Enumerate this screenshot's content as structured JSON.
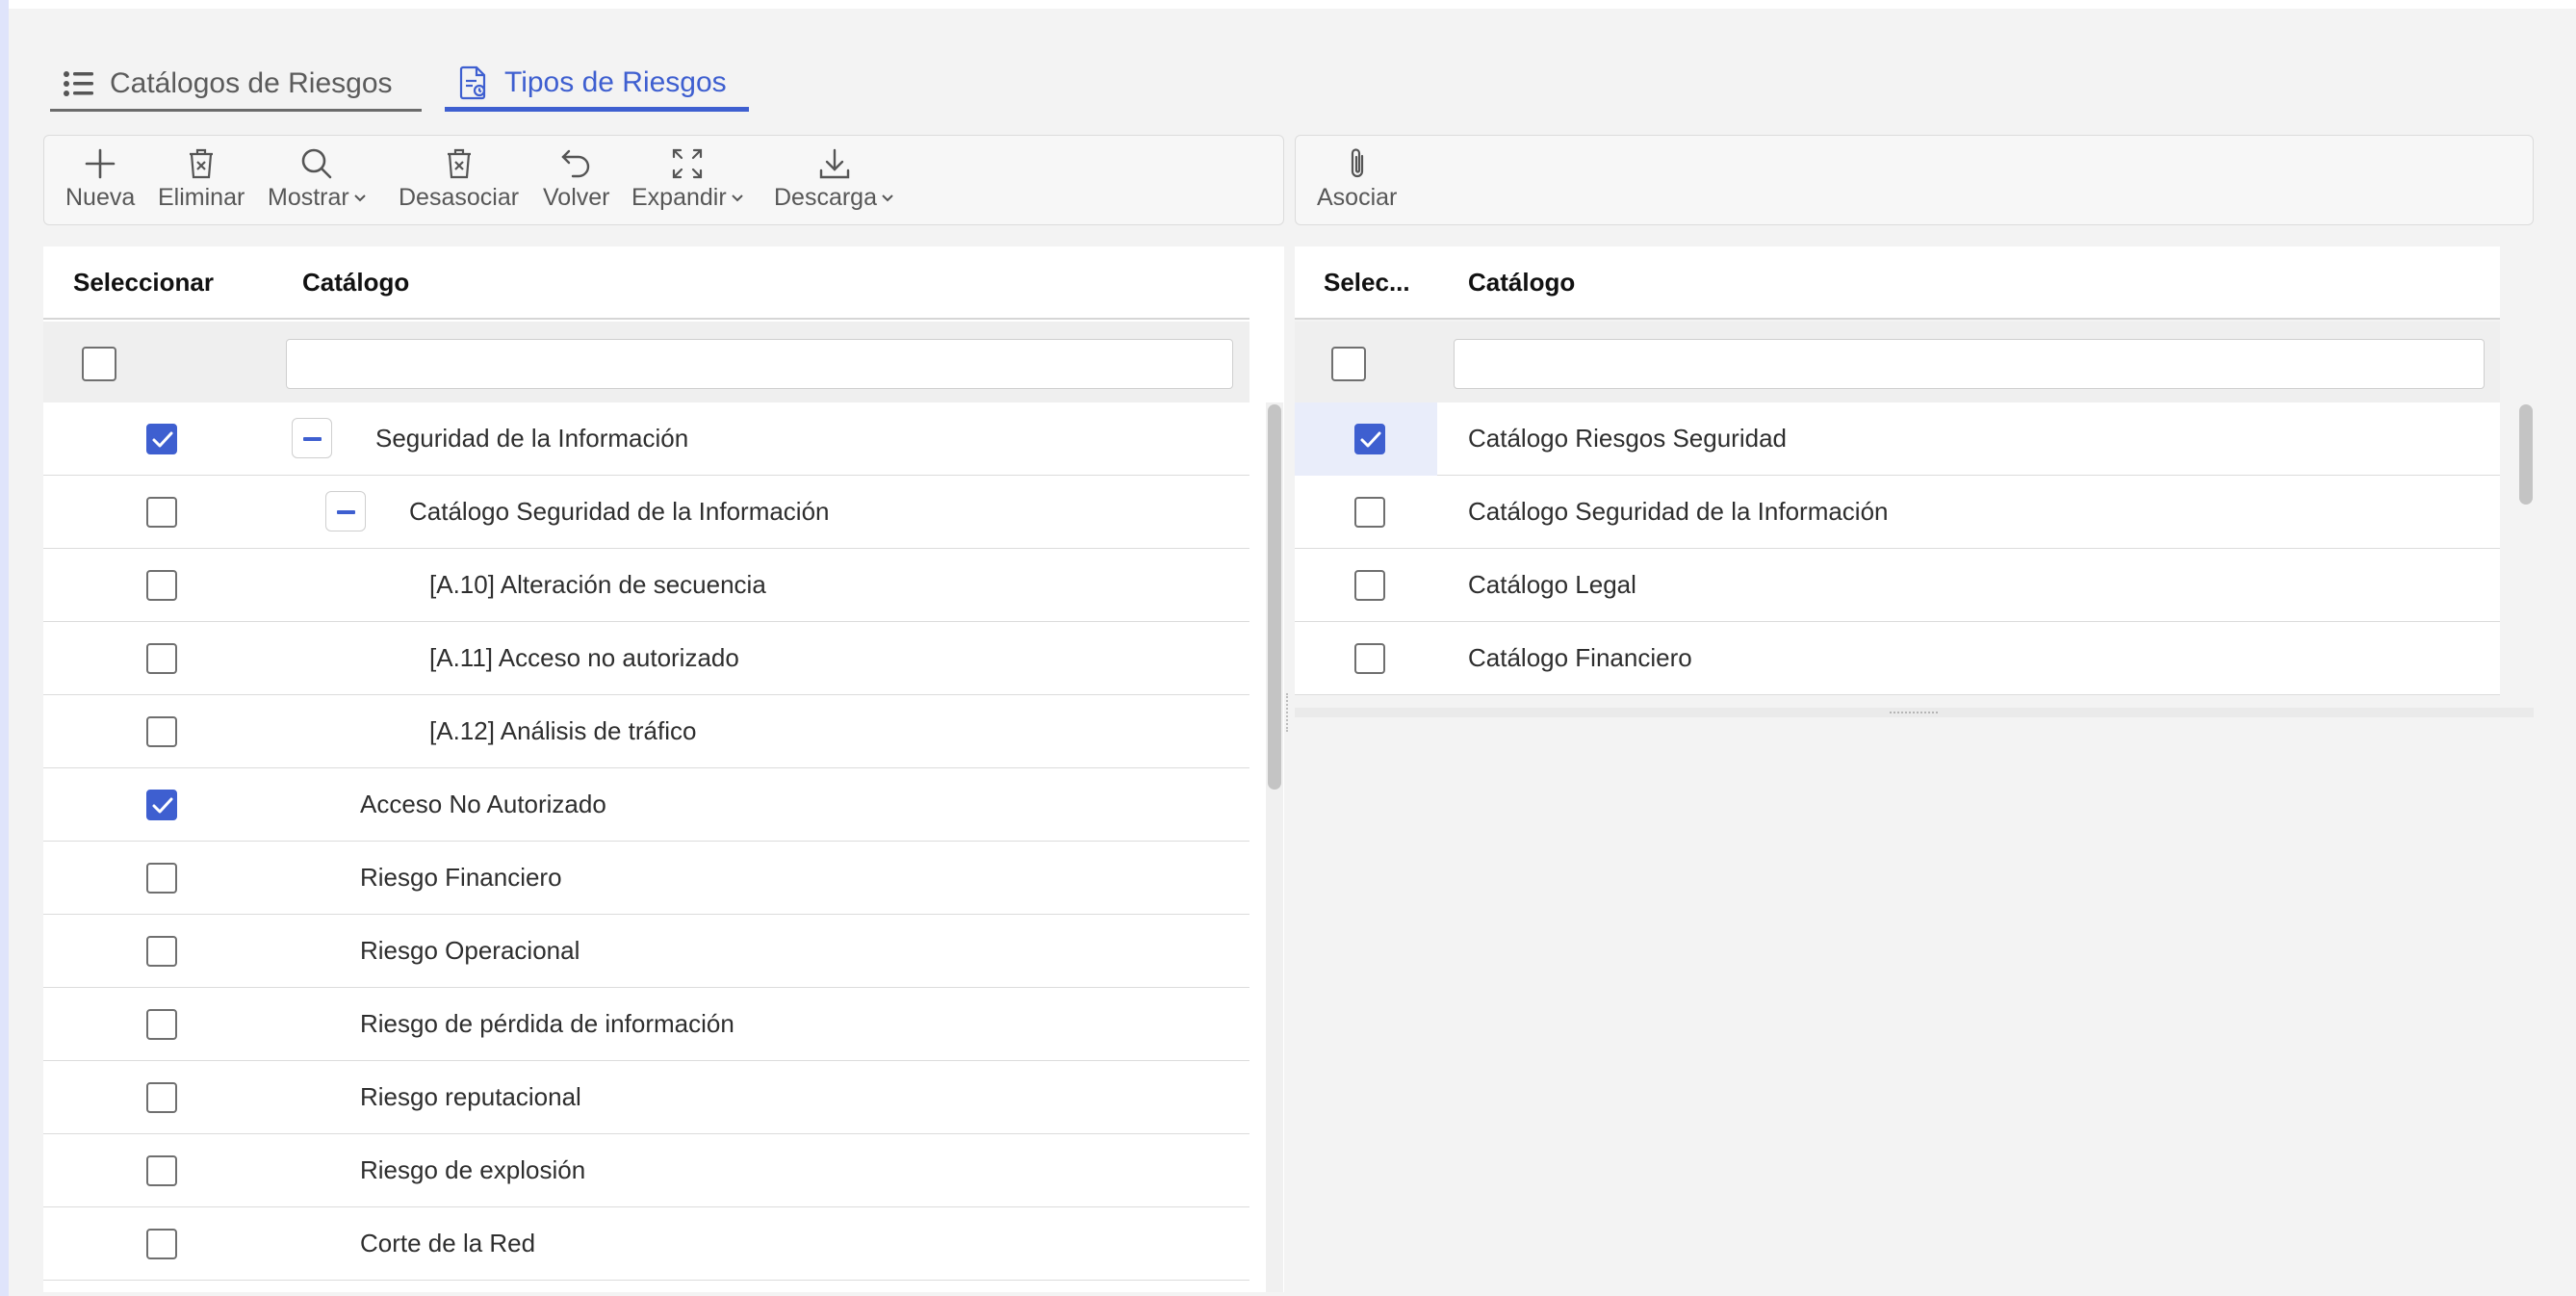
{
  "tabs": [
    {
      "label": "Catálogos de Riesgos",
      "icon": "list-icon",
      "active": false
    },
    {
      "label": "Tipos de Riesgos",
      "icon": "document-icon",
      "active": true
    }
  ],
  "toolbar_left": {
    "nueva": "Nueva",
    "eliminar": "Eliminar",
    "mostrar": "Mostrar",
    "desasociar": "Desasociar",
    "volver": "Volver",
    "expandir": "Expandir",
    "descarga": "Descarga"
  },
  "toolbar_right": {
    "asociar": "Asociar"
  },
  "left_grid": {
    "col_select": "Seleccionar",
    "col_catalog": "Catálogo",
    "filter_value": "",
    "rows": [
      {
        "label": "Seguridad de la Información",
        "checked": true,
        "toggle": true
      },
      {
        "label": "Catálogo Seguridad de la Información",
        "checked": false,
        "toggle": true
      },
      {
        "label": "[A.10] Alteración de secuencia",
        "checked": false,
        "toggle": false
      },
      {
        "label": "[A.11] Acceso no autorizado",
        "checked": false,
        "toggle": false
      },
      {
        "label": "[A.12] Análisis de tráfico",
        "checked": false,
        "toggle": false
      },
      {
        "label": "Acceso No Autorizado",
        "checked": true,
        "toggle": false
      },
      {
        "label": "Riesgo Financiero",
        "checked": false,
        "toggle": false
      },
      {
        "label": "Riesgo Operacional",
        "checked": false,
        "toggle": false
      },
      {
        "label": "Riesgo de pérdida de información",
        "checked": false,
        "toggle": false
      },
      {
        "label": "Riesgo reputacional",
        "checked": false,
        "toggle": false
      },
      {
        "label": "Riesgo de explosión",
        "checked": false,
        "toggle": false
      },
      {
        "label": "Corte de la Red",
        "checked": false,
        "toggle": false
      }
    ]
  },
  "right_grid": {
    "col_select": "Selec...",
    "col_catalog": "Catálogo",
    "filter_value": "",
    "rows": [
      {
        "label": "Catálogo Riesgos Seguridad",
        "checked": true
      },
      {
        "label": "Catálogo Seguridad de la Información",
        "checked": false
      },
      {
        "label": "Catálogo Legal",
        "checked": false
      },
      {
        "label": "Catálogo Financiero",
        "checked": false
      }
    ]
  },
  "colors": {
    "accent": "#3e5fd0",
    "selected_row": "#e9edfa"
  }
}
